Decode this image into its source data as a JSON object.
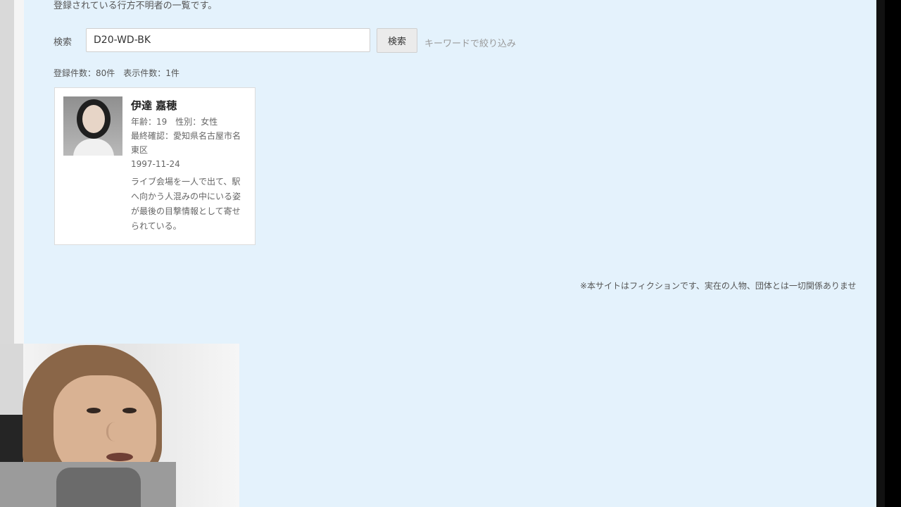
{
  "page": {
    "intro": "登録されている行方不明者の一覧です。",
    "search": {
      "label": "検索",
      "value": "D20-WD-BK",
      "button_label": "検索",
      "hint": "キーワードで絞り込み"
    },
    "counts": "登録件数：80件　表示件数：1件",
    "result": {
      "name": "伊達 嘉穂",
      "meta_line": "年齢：19　性別：女性",
      "last_seen": "最終確認：愛知県名古屋市名東区",
      "date": "1997-11-24",
      "description": "ライブ会場を一人で出て、駅へ向かう人混みの中にいる姿が最後の目撃情報として寄せられている。"
    },
    "notice": "※本サイトはフィクションです、実在の人物、団体とは一切関係ありませ"
  },
  "colors": {
    "background": "#e4f2fc",
    "card": "#ffffff",
    "text": "#555555",
    "button": "#ebebeb"
  },
  "icons": {
    "person_photo": "person-photo-icon",
    "webcam": "webcam-feed-icon"
  }
}
